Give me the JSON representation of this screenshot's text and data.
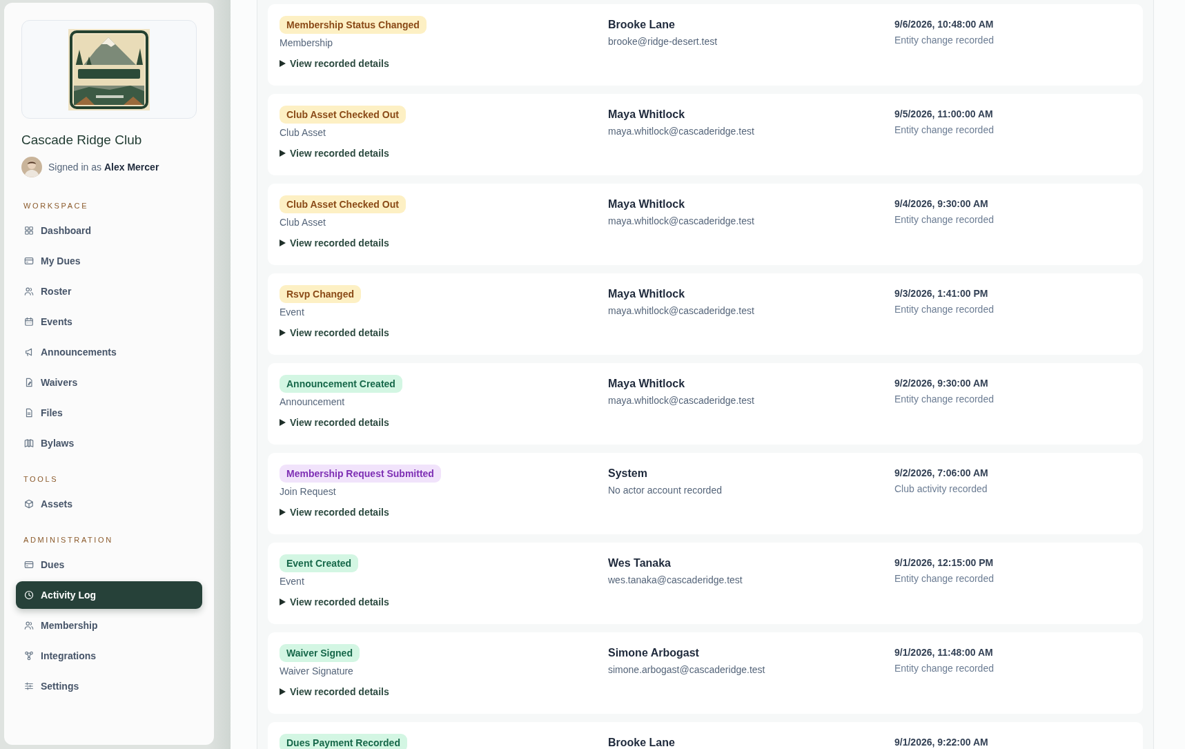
{
  "sidebar": {
    "club_name": "Cascade Ridge Club",
    "signed_in_prefix": "Signed in as",
    "user_name": "Alex Mercer",
    "sections": [
      {
        "label": "WORKSPACE",
        "items": [
          {
            "label": "Dashboard",
            "selected": false
          },
          {
            "label": "My Dues",
            "selected": false
          },
          {
            "label": "Roster",
            "selected": false
          },
          {
            "label": "Events",
            "selected": false
          },
          {
            "label": "Announcements",
            "selected": false
          },
          {
            "label": "Waivers",
            "selected": false
          },
          {
            "label": "Files",
            "selected": false
          },
          {
            "label": "Bylaws",
            "selected": false
          }
        ]
      },
      {
        "label": "TOOLS",
        "items": [
          {
            "label": "Assets",
            "selected": false
          }
        ]
      },
      {
        "label": "ADMINISTRATION",
        "items": [
          {
            "label": "Dues",
            "selected": false
          },
          {
            "label": "Activity Log",
            "selected": true
          },
          {
            "label": "Membership",
            "selected": false
          },
          {
            "label": "Integrations",
            "selected": false
          },
          {
            "label": "Settings",
            "selected": false
          }
        ]
      }
    ]
  },
  "activity": [
    {
      "badge": "Membership Status Changed",
      "color": "#fdf0c4",
      "entity": "Membership",
      "details": "View recorded details",
      "actor": "Brooke Lane",
      "actor_detail": "brooke@ridge-desert.test",
      "timestamp": "9/6/2026, 10:48:00 AM",
      "summary": "Entity change recorded"
    },
    {
      "badge": "Club Asset Checked Out",
      "color": "#fdf0c4",
      "entity": "Club Asset",
      "details": "View recorded details",
      "actor": "Maya Whitlock",
      "actor_detail": "maya.whitlock@cascaderidge.test",
      "timestamp": "9/5/2026, 11:00:00 AM",
      "summary": "Entity change recorded"
    },
    {
      "badge": "Club Asset Checked Out",
      "color": "#fdf0c4",
      "entity": "Club Asset",
      "details": "View recorded details",
      "actor": "Maya Whitlock",
      "actor_detail": "maya.whitlock@cascaderidge.test",
      "timestamp": "9/4/2026, 9:30:00 AM",
      "summary": "Entity change recorded"
    },
    {
      "badge": "Rsvp Changed",
      "color": "#fdf0c4",
      "entity": "Event",
      "details": "View recorded details",
      "actor": "Maya Whitlock",
      "actor_detail": "maya.whitlock@cascaderidge.test",
      "timestamp": "9/3/2026, 1:41:00 PM",
      "summary": "Entity change recorded"
    },
    {
      "badge": "Announcement Created",
      "color": "#d3f6e3",
      "entity": "Announcement",
      "details": "View recorded details",
      "actor": "Maya Whitlock",
      "actor_detail": "maya.whitlock@cascaderidge.test",
      "timestamp": "9/2/2026, 9:30:00 AM",
      "summary": "Entity change recorded"
    },
    {
      "badge": "Membership Request Submitted",
      "color": "#f1e3fb",
      "entity": "Join Request",
      "details": "View recorded details",
      "actor": "System",
      "actor_detail": "No actor account recorded",
      "timestamp": "9/2/2026, 7:06:00 AM",
      "summary": "Club activity recorded"
    },
    {
      "badge": "Event Created",
      "color": "#d3f6e3",
      "entity": "Event",
      "details": "View recorded details",
      "actor": "Wes Tanaka",
      "actor_detail": "wes.tanaka@cascaderidge.test",
      "timestamp": "9/1/2026, 12:15:00 PM",
      "summary": "Entity change recorded"
    },
    {
      "badge": "Waiver Signed",
      "color": "#d3f6e3",
      "entity": "Waiver Signature",
      "details": "View recorded details",
      "actor": "Simone Arbogast",
      "actor_detail": "simone.arbogast@cascaderidge.test",
      "timestamp": "9/1/2026, 11:48:00 AM",
      "summary": "Entity change recorded"
    },
    {
      "badge": "Dues Payment Recorded",
      "color": "#d3f6e3",
      "actor": "Brooke Lane",
      "timestamp": "9/1/2026, 9:22:00 AM"
    }
  ]
}
